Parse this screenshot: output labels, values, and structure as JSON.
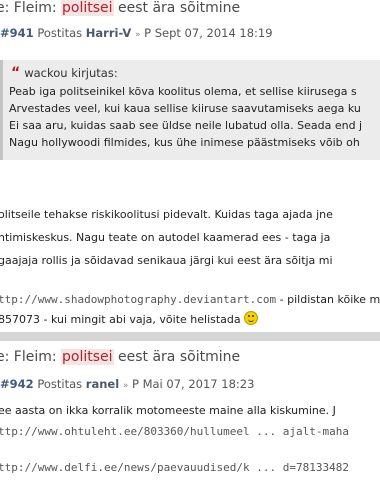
{
  "post1": {
    "title_prefix": "e: Fleim: ",
    "title_highlight": "politsei",
    "title_suffix": " eest ära sõitmine",
    "number": "#941",
    "posted_label": "Postitas",
    "author": "Harri-V",
    "date": "P Sept 07, 2014 18:19",
    "quote_author": "wackou kirjutas:",
    "quote_lines": [
      "Peab iga politseinikel kõva koolitus olema, et sellise kiirusega s",
      "Arvestades veel, kui kaua sellise kiiruse saavutamiseks aega ku",
      "Ei saa aru, kuidas saab see üldse neile lubatud olla. Seada end j",
      "Nagu hollywoodi filmides, kus ühe inimese päästmiseks võib oh"
    ],
    "body_lines": [
      "olitseile tehakse riskikoolitusi pidevalt. Kuidas taga ajada jne",
      "htimiskeskus. Nagu teate on autodel kaamerad ees - taga ja",
      "gaajaja rollis ja sõidavad senikaua järgi kui eest ära sõitja mi"
    ],
    "signature_link": "ttp://www.shadowphotography.deviantart.com",
    "signature_text": " - pildistan kõike m",
    "signature_line2": "857073 - kui mingit abi vaja, võite helistada"
  },
  "post2": {
    "title_prefix": "e: Fleim: ",
    "title_highlight": "politsei",
    "title_suffix": " eest ära sõitmine",
    "number": "#942",
    "posted_label": "Postitas",
    "author": "ranel",
    "date": "P Mai 07, 2017 18:23",
    "body_line": "ee aasta on ikka korralik motomeeste maine alla kiskumine. J",
    "link1": "ttp://www.ohtuleht.ee/803360/hullumeel ... ajalt-maha",
    "link2": "ttp://www.delfi.ee/news/paevauudised/k ... d=78133482"
  },
  "icons": {
    "post_arrow": "arrow-right-icon",
    "quote": "quote-icon",
    "smiley": "smiley-icon"
  },
  "colors": {
    "highlight": "#b8202a",
    "quote_icon": "#b21c26",
    "post_number": "#3f5a7a",
    "separator": "#d6d6d6"
  }
}
